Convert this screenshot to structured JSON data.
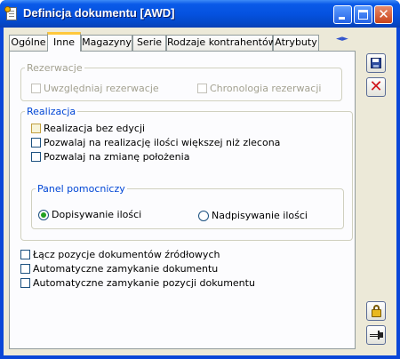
{
  "window": {
    "title": "Definicja dokumentu [AWD]"
  },
  "tabs": [
    {
      "label": "Ogólne",
      "active": false
    },
    {
      "label": "Inne",
      "active": true
    },
    {
      "label": "Magazyny",
      "active": false
    },
    {
      "label": "Serie",
      "active": false
    },
    {
      "label": "Rodzaje kontrahentów",
      "active": false
    },
    {
      "label": "Atrybuty",
      "active": false
    }
  ],
  "tab_scroll": {
    "arrows": "◄►"
  },
  "rezerwacje": {
    "legend": "Rezerwacje",
    "uwzgledniaj": {
      "label": "Uwzględniaj rezerwacje",
      "checked": false,
      "enabled": false
    },
    "chronologia": {
      "label": "Chronologia rezerwacji",
      "checked": false,
      "enabled": false
    }
  },
  "realizacja": {
    "legend": "Realizacja",
    "bez_edycji": {
      "label": "Realizacja bez edycji",
      "checked": false
    },
    "ilosci_wiekszej": {
      "label": "Pozwalaj na realizację ilości większej niż zlecona",
      "checked": false
    },
    "zmiane_polozenia": {
      "label": "Pozwalaj na zmianę położenia",
      "checked": false
    },
    "panel": {
      "legend": "Panel pomocniczy",
      "dopisywanie": {
        "label": "Dopisywanie ilości",
        "selected": true
      },
      "nadpisywanie": {
        "label": "Nadpisywanie ilości",
        "selected": false
      }
    }
  },
  "options": {
    "lacz": {
      "label": "Łącz pozycje dokumentów źródłowych",
      "checked": false
    },
    "zamykanie_dok": {
      "label": "Automatyczne zamykanie dokumentu",
      "checked": false
    },
    "zamykanie_poz": {
      "label": "Automatyczne zamykanie pozycji dokumentu",
      "checked": false
    }
  },
  "colors": {
    "title_bar": "#0552e0",
    "active_tab_accent": "#ffc83c",
    "group_legend": "#0046d5",
    "radio_dot": "#21a121",
    "cancel": "#d0141a"
  },
  "icons": [
    "save-icon",
    "cancel-icon",
    "lock-icon",
    "pin-icon"
  ]
}
